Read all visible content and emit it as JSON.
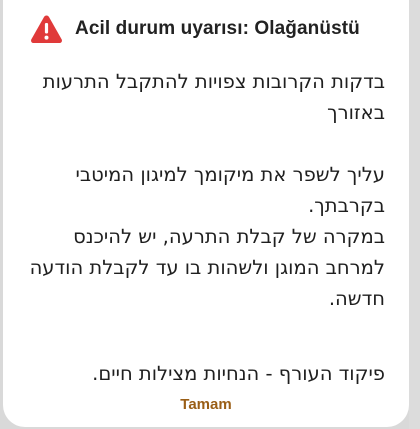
{
  "dialog": {
    "title": "Acil durum uyarısı: Olağanüstü",
    "icon": "warning-triangle-icon",
    "accent_color": "#e03a3a",
    "message": {
      "line1": "בדקות הקרובות צפויות להתקבל התרעות באזורך",
      "line2": "עליך לשפר את מיקומך למיגון המיטבי בקרבתך.",
      "line3": "במקרה של קבלת התרעה, יש להיכנס למרחב המוגן ולשהות בו עד לקבלת הודעה חדשה.",
      "line4": "פיקוד העורף - הנחיות מצילות חיים."
    },
    "ok_label": "Tamam",
    "ok_color": "#9a5e16"
  }
}
